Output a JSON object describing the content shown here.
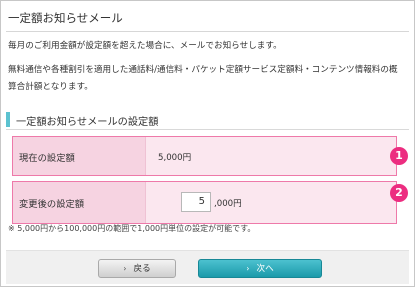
{
  "page": {
    "title": "一定額お知らせメール"
  },
  "description": {
    "line1": "毎月のご利用金額が設定額を超えた場合に、メールでお知らせします。",
    "line2": "無料通信や各種割引を適用した通話料/通信料・パケット定額サービス定額料・コンテンツ情報料の概",
    "line3": "算合計額となります。"
  },
  "section": {
    "title": "一定額お知らせメールの設定額"
  },
  "settings": {
    "current": {
      "label": "現在の設定額",
      "value": "5,000円",
      "badge": "1"
    },
    "new": {
      "label": "変更後の設定額",
      "input_value": "5",
      "unit": ",000円",
      "badge": "2"
    }
  },
  "note": "※ 5,000円から100,000円の範囲で1,000円単位の設定が可能です。",
  "buttons": {
    "back_label": "戻る",
    "next_label": "次へ",
    "chevron": "›"
  },
  "colors": {
    "accent_teal": "#1b9aaa",
    "highlight_pink": "#ee79a9",
    "badge_pink": "#ec2d80",
    "row_fill": "#fbe7ef"
  },
  "icons": {
    "back": "chevron-right-icon",
    "next": "chevron-right-icon"
  }
}
